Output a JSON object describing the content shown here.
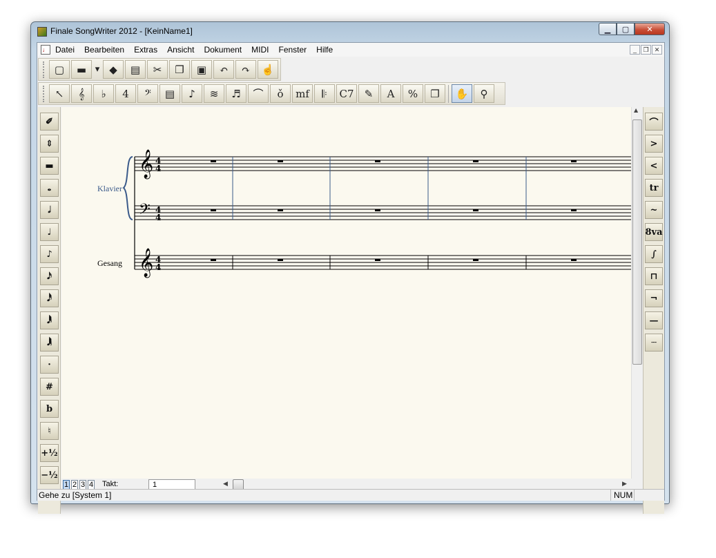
{
  "window": {
    "title": "Finale SongWriter 2012 - [KeinName1]"
  },
  "menu": [
    "Datei",
    "Bearbeiten",
    "Extras",
    "Ansicht",
    "Dokument",
    "MIDI",
    "Fenster",
    "Hilfe"
  ],
  "toolbar1": [
    {
      "name": "new-document-icon",
      "glyph": "▢"
    },
    {
      "name": "open-folder-icon",
      "glyph": "▬"
    },
    {
      "name": "dropdown-arrow-icon",
      "glyph": "▾"
    },
    {
      "name": "save-disk-icon",
      "glyph": "◆"
    },
    {
      "name": "print-icon",
      "glyph": "▤"
    },
    {
      "name": "cut-icon",
      "glyph": "✂"
    },
    {
      "name": "copy-icon",
      "glyph": "❐"
    },
    {
      "name": "paste-icon",
      "glyph": "▣"
    },
    {
      "name": "undo-icon",
      "glyph": "↶"
    },
    {
      "name": "redo-icon",
      "glyph": "↷"
    },
    {
      "name": "hand-point-icon",
      "glyph": "☝"
    }
  ],
  "toolbar2": [
    {
      "name": "selection-tool-icon",
      "glyph": "↖"
    },
    {
      "name": "staff-tool-icon",
      "glyph": "𝄞"
    },
    {
      "name": "key-signature-tool-icon",
      "glyph": "♭"
    },
    {
      "name": "time-signature-tool-icon",
      "glyph": "4"
    },
    {
      "name": "clef-tool-icon",
      "glyph": "𝄢"
    },
    {
      "name": "measure-tool-icon",
      "glyph": "▤"
    },
    {
      "name": "simple-entry-icon",
      "glyph": "♪"
    },
    {
      "name": "speedy-entry-icon",
      "glyph": "≋"
    },
    {
      "name": "tuplet-tool-icon",
      "glyph": "♬"
    },
    {
      "name": "smart-shape-tool-icon",
      "glyph": "⌒"
    },
    {
      "name": "articulation-tool-icon",
      "glyph": "ǒ"
    },
    {
      "name": "expression-tool-icon",
      "glyph": "mf"
    },
    {
      "name": "repeat-tool-icon",
      "glyph": "𝄆"
    },
    {
      "name": "chord-tool-icon",
      "glyph": "C7"
    },
    {
      "name": "lyrics-tool-icon",
      "glyph": "✎"
    },
    {
      "name": "text-tool-icon",
      "glyph": "A"
    },
    {
      "name": "resize-tool-icon",
      "glyph": "%"
    },
    {
      "name": "page-layout-tool-icon",
      "glyph": "❐"
    },
    {
      "name": "hand-grabber-icon",
      "glyph": "✋"
    },
    {
      "name": "zoom-tool-icon",
      "glyph": "⚲"
    }
  ],
  "left_palette": [
    {
      "name": "eraser-icon",
      "glyph": "✐"
    },
    {
      "name": "updown-arrows-icon",
      "glyph": "⇕"
    },
    {
      "name": "rest-icon",
      "glyph": "▬"
    },
    {
      "name": "whole-note-icon",
      "glyph": "𝅝"
    },
    {
      "name": "half-note-icon",
      "glyph": "𝅗𝅥"
    },
    {
      "name": "quarter-note-icon",
      "glyph": "♩"
    },
    {
      "name": "eighth-note-icon",
      "glyph": "♪"
    },
    {
      "name": "sixteenth-note-icon",
      "glyph": "𝅘𝅥𝅯"
    },
    {
      "name": "thirty-second-note-icon",
      "glyph": "𝅘𝅥𝅰"
    },
    {
      "name": "sixty-fourth-note-icon",
      "glyph": "𝅘𝅥𝅱"
    },
    {
      "name": "hundred-twenty-eighth-note-icon",
      "glyph": "𝅘𝅥𝅲"
    },
    {
      "name": "dot-icon",
      "glyph": "·"
    },
    {
      "name": "sharp-icon",
      "glyph": "#"
    },
    {
      "name": "flat-icon",
      "glyph": "b"
    },
    {
      "name": "natural-icon",
      "glyph": "♮"
    },
    {
      "name": "half-step-up-icon",
      "glyph": "+½"
    },
    {
      "name": "half-step-down-icon",
      "glyph": "−½"
    }
  ],
  "right_palette": [
    {
      "name": "slur-icon",
      "glyph": "⌒"
    },
    {
      "name": "decrescendo-icon",
      "glyph": ">"
    },
    {
      "name": "crescendo-icon",
      "glyph": "<"
    },
    {
      "name": "trill-icon",
      "glyph": "tr"
    },
    {
      "name": "trill-extension-icon",
      "glyph": "~"
    },
    {
      "name": "ottava-icon",
      "glyph": "8va"
    },
    {
      "name": "glissando-icon",
      "glyph": "∫"
    },
    {
      "name": "bracket-icon",
      "glyph": "⊓"
    },
    {
      "name": "bracket-end-icon",
      "glyph": "¬"
    },
    {
      "name": "line-icon",
      "glyph": "—"
    },
    {
      "name": "dashed-line-icon",
      "glyph": "┄"
    }
  ],
  "score": {
    "staves": [
      {
        "label": "Klavier"
      },
      {
        "label": "Gesang"
      }
    ],
    "time_signature": "4/4",
    "measures": 5
  },
  "bottom": {
    "pages": [
      "1",
      "2",
      "3",
      "4"
    ],
    "takt_label": "Takt:",
    "takt_value": "1"
  },
  "status": {
    "text": "Gehe zu [System 1]",
    "num": "NUM"
  }
}
